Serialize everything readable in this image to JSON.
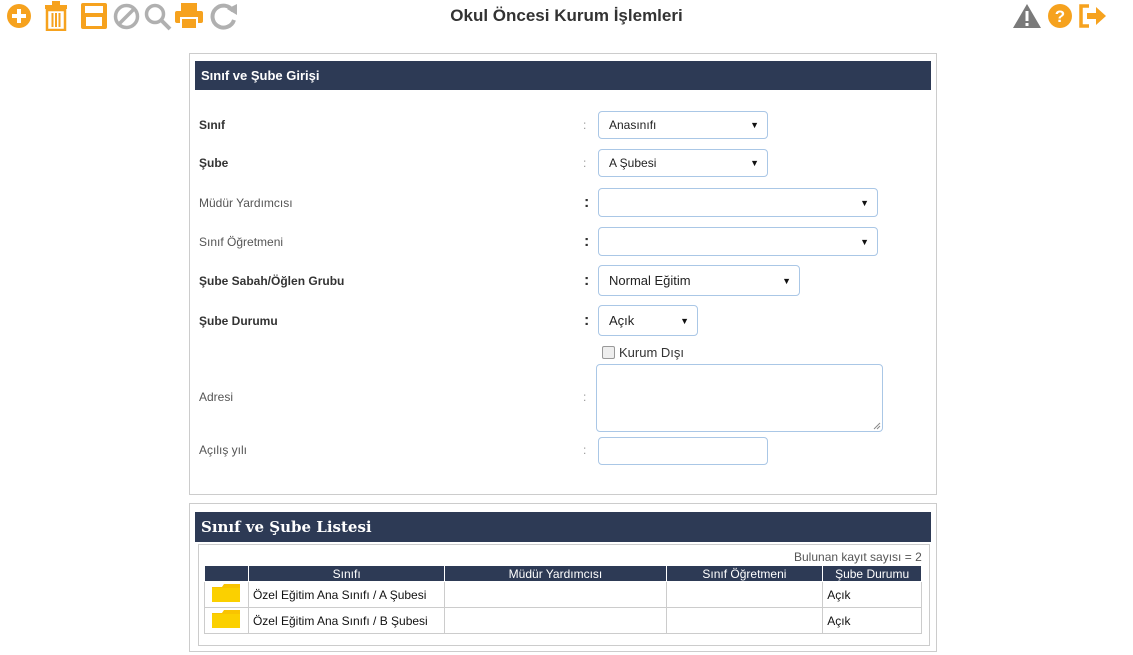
{
  "header": {
    "title": "Okul Öncesi Kurum İşlemleri"
  },
  "toolbar": {
    "left_icons": [
      "add-icon",
      "trash-icon",
      "save-icon",
      "cancel-icon",
      "search-icon",
      "print-icon",
      "refresh-icon"
    ],
    "right_icons": [
      "warning-icon",
      "help-icon",
      "exit-icon"
    ],
    "accent_color": "#f6a21e",
    "gray_color": "#b0b0b0"
  },
  "form": {
    "title": "Sınıf ve Şube Girişi",
    "fields": {
      "sinif": {
        "label": "Sınıf",
        "value": "Anasınıfı"
      },
      "sube": {
        "label": "Şube",
        "value": "A Şubesi"
      },
      "mudur_yardimcisi": {
        "label": "Müdür Yardımcısı",
        "value": ""
      },
      "sinif_ogretmeni": {
        "label": "Sınıf Öğretmeni",
        "value": ""
      },
      "sabah_oglen": {
        "label": "Şube Sabah/Öğlen Grubu",
        "value": "Normal Eğitim"
      },
      "sube_durumu": {
        "label": "Şube Durumu",
        "value": "Açık"
      },
      "kurum_disi": {
        "label": "Kurum Dışı",
        "checked": false
      },
      "adresi": {
        "label": "Adresi",
        "value": ""
      },
      "acilis_yili": {
        "label": "Açılış yılı",
        "value": ""
      }
    },
    "colon": ":"
  },
  "list": {
    "title": "Sınıf ve Şube Listesi",
    "count_text": "Bulunan kayıt sayısı = 2",
    "columns": [
      "Sınıfı",
      "Müdür Yardımcısı",
      "Sınıf Öğretmeni",
      "Şube Durumu"
    ],
    "rows": [
      {
        "sinifi": "Özel Eğitim Ana Sınıfı / A Şubesi",
        "mudur": "",
        "ogretmen": "",
        "durum": "Açık"
      },
      {
        "sinifi": "Özel Eğitim Ana Sınıfı / B Şubesi",
        "mudur": "",
        "ogretmen": "",
        "durum": "Açık"
      }
    ]
  },
  "colors": {
    "header_bg": "#2d3a55",
    "input_border": "#aac7e6",
    "folder": "#f9c400"
  }
}
